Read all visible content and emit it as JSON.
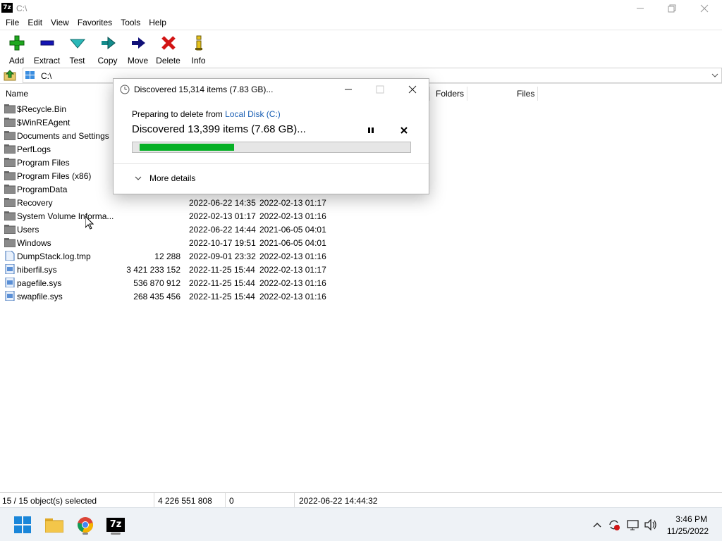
{
  "window": {
    "app_icon_text": "7z",
    "title": "C:\\"
  },
  "menu": [
    "File",
    "Edit",
    "View",
    "Favorites",
    "Tools",
    "Help"
  ],
  "toolbar": [
    {
      "label": "Add",
      "icon": "add-icon",
      "color": "#1ea81e"
    },
    {
      "label": "Extract",
      "icon": "extract-icon",
      "color": "#1414b4"
    },
    {
      "label": "Test",
      "icon": "test-icon",
      "color": "#2ab8b8"
    },
    {
      "label": "Copy",
      "icon": "copy-icon",
      "color": "#148c8c"
    },
    {
      "label": "Move",
      "icon": "move-icon",
      "color": "#101078"
    },
    {
      "label": "Delete",
      "icon": "delete-icon",
      "color": "#d21414"
    },
    {
      "label": "Info",
      "icon": "info-icon",
      "color": "#b49614"
    }
  ],
  "address": {
    "path": "C:\\"
  },
  "columns": {
    "name": "Name",
    "folders": "Folders",
    "files": "Files"
  },
  "files": [
    {
      "name": "$Recycle.Bin",
      "type": "folder",
      "size": "",
      "modified": "",
      "created": ""
    },
    {
      "name": "$WinREAgent",
      "type": "folder",
      "size": "",
      "modified": "",
      "created": ""
    },
    {
      "name": "Documents and Settings",
      "type": "folder",
      "size": "",
      "modified": "",
      "created": ""
    },
    {
      "name": "PerfLogs",
      "type": "folder",
      "size": "",
      "modified": "",
      "created": ""
    },
    {
      "name": "Program Files",
      "type": "folder",
      "size": "",
      "modified": "",
      "created": ""
    },
    {
      "name": "Program Files (x86)",
      "type": "folder",
      "size": "",
      "modified": "",
      "created": ""
    },
    {
      "name": "ProgramData",
      "type": "folder",
      "size": "",
      "modified": "",
      "created": ""
    },
    {
      "name": "Recovery",
      "type": "folder",
      "size": "",
      "modified": "2022-06-22 14:35",
      "created": "2022-02-13 01:17"
    },
    {
      "name": "System Volume Informa...",
      "type": "folder",
      "size": "",
      "modified": "2022-02-13 01:17",
      "created": "2022-02-13 01:16"
    },
    {
      "name": "Users",
      "type": "folder",
      "size": "",
      "modified": "2022-06-22 14:44",
      "created": "2021-06-05 04:01"
    },
    {
      "name": "Windows",
      "type": "folder",
      "size": "",
      "modified": "2022-10-17 19:51",
      "created": "2021-06-05 04:01"
    },
    {
      "name": "DumpStack.log.tmp",
      "type": "file",
      "size": "12 288",
      "modified": "2022-09-01 23:32",
      "created": "2022-02-13 01:16"
    },
    {
      "name": "hiberfil.sys",
      "type": "sysfile",
      "size": "3 421 233 152",
      "modified": "2022-11-25 15:44",
      "created": "2022-02-13 01:17"
    },
    {
      "name": "pagefile.sys",
      "type": "sysfile",
      "size": "536 870 912",
      "modified": "2022-11-25 15:44",
      "created": "2022-02-13 01:16"
    },
    {
      "name": "swapfile.sys",
      "type": "sysfile",
      "size": "268 435 456",
      "modified": "2022-11-25 15:44",
      "created": "2022-02-13 01:16"
    }
  ],
  "status": {
    "selected": "15 / 15 object(s) selected",
    "total_size": "4 226 551 808",
    "packed": "0",
    "date": "2022-06-22 14:44:32"
  },
  "dialog": {
    "title": "Discovered 15,314 items (7.83 GB)...",
    "prep_prefix": "Preparing to delete from",
    "prep_target": "Local Disk (C:)",
    "status": "Discovered 13,399 items (7.68 GB)...",
    "progress": 0.35,
    "more_details": "More details",
    "progress_color": "#06b025",
    "link_color": "#1a5fb4"
  },
  "taskbar": {
    "apps": [
      "start-icon",
      "file-explorer-icon",
      "chrome-icon",
      "7zip-icon"
    ],
    "app_7z_text": "7z",
    "time": "3:46 PM",
    "date": "11/25/2022"
  }
}
